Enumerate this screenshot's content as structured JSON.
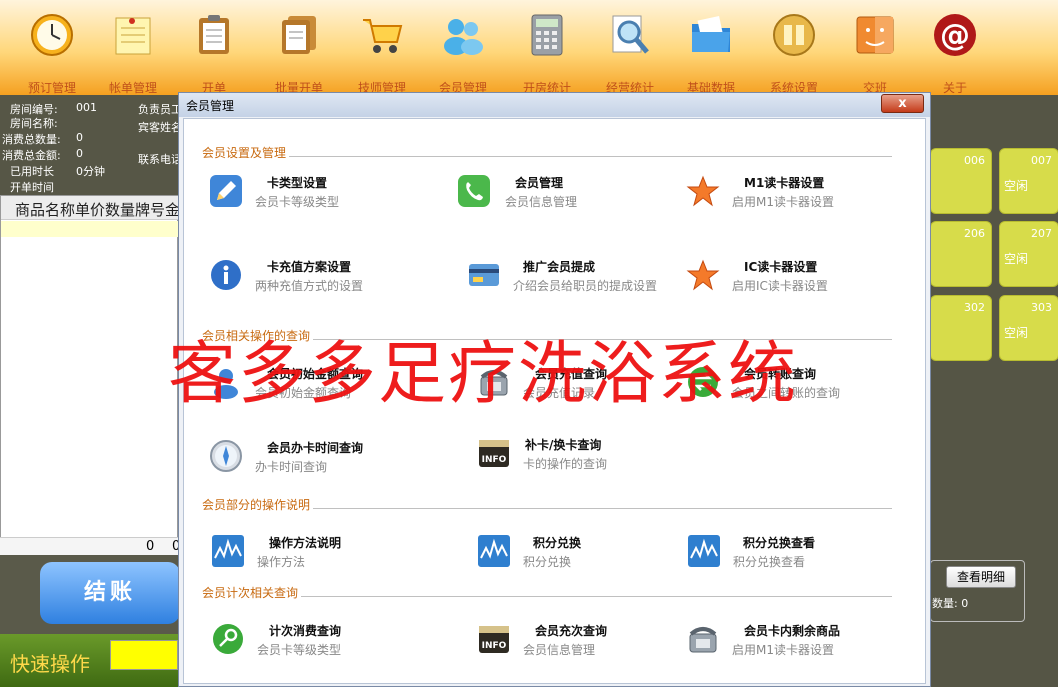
{
  "toolbar": {
    "items": [
      {
        "label": "预订管理",
        "icon": "clock-icon"
      },
      {
        "label": "帐单管理",
        "icon": "notepad-icon"
      },
      {
        "label": "开单",
        "icon": "clipboard-icon"
      },
      {
        "label": "批量开单",
        "icon": "clipboard-batch-icon"
      },
      {
        "label": "技师管理",
        "icon": "cart-icon"
      },
      {
        "label": "会员管理",
        "icon": "members-icon"
      },
      {
        "label": "开房统计",
        "icon": "calculator-icon"
      },
      {
        "label": "经营统计",
        "icon": "magnifier-icon"
      },
      {
        "label": "基础数据",
        "icon": "folder-icon"
      },
      {
        "label": "系统设置",
        "icon": "books-icon"
      },
      {
        "label": "交班",
        "icon": "handover-icon"
      },
      {
        "label": "关于",
        "icon": "at-icon"
      }
    ]
  },
  "left_info": {
    "room_no_label": "房间编号:",
    "room_no_value": "001",
    "room_name_label": "房间名称:",
    "consume_count_label": "消费总数量:",
    "consume_count_value": "0",
    "consume_amount_label": "消费总金额:",
    "consume_amount_value": "0",
    "used_time_label": "已用时长",
    "used_time_value": "0分钟",
    "open_time_label": "开单时间",
    "responsible_label": "负责员工",
    "guest_name_label": "宾客姓名",
    "contact_label": "联系电话"
  },
  "goods_table": {
    "header": "商品名称单价数量牌号金额",
    "footer_value_1": "0",
    "footer_value_2": "0"
  },
  "checkout_label": "结账",
  "quick_label": "快速操作",
  "rooms": [
    {
      "num": "006",
      "status": ""
    },
    {
      "num": "007",
      "status": "空闲"
    },
    {
      "num": "206",
      "status": ""
    },
    {
      "num": "207",
      "status": "空闲"
    },
    {
      "num": "302",
      "status": ""
    },
    {
      "num": "303",
      "status": "空闲"
    }
  ],
  "detail": {
    "button": "查看明细",
    "count_label": "数量: 0"
  },
  "dialog": {
    "title": "会员管理",
    "close_label": "x",
    "sections": [
      {
        "title": "会员设置及管理"
      },
      {
        "title": "会员相关操作的查询"
      },
      {
        "title": "会员部分的操作说明"
      },
      {
        "title": "会员计次相关查询"
      }
    ],
    "items": [
      {
        "title": "卡类型设置",
        "desc": "会员卡等级类型",
        "icon": "pencil-icon"
      },
      {
        "title": "会员管理",
        "desc": "会员信息管理",
        "icon": "phone-icon"
      },
      {
        "title": "M1读卡器设置",
        "desc": "启用M1读卡器设置",
        "icon": "star-icon"
      },
      {
        "title": "卡充值方案设置",
        "desc": "两种充值方式的设置",
        "icon": "info-icon"
      },
      {
        "title": "推广会员提成",
        "desc": "介绍会员给职员的提成设置",
        "icon": "card-icon"
      },
      {
        "title": "IC读卡器设置",
        "desc": "启用IC读卡器设置",
        "icon": "star-icon"
      },
      {
        "title": "会员初始金额查询",
        "desc": "会员初始金额查询",
        "icon": "user-icon"
      },
      {
        "title": "会员充值查询",
        "desc": "会员充值记录",
        "icon": "telephone-icon"
      },
      {
        "title": "会员转账查询",
        "desc": "会员之间转账的查询",
        "icon": "transfer-icon"
      },
      {
        "title": "会员办卡时间查询",
        "desc": "办卡时间查询",
        "icon": "compass-icon"
      },
      {
        "title": "补卡/换卡查询",
        "desc": "卡的操作的查询",
        "icon": "info-box-icon"
      },
      {
        "title": "操作方法说明",
        "desc": "操作方法",
        "icon": "chart-icon"
      },
      {
        "title": "积分兑换",
        "desc": "积分兑换",
        "icon": "chart-icon"
      },
      {
        "title": "积分兑换查看",
        "desc": "积分兑换查看",
        "icon": "chart-icon"
      },
      {
        "title": "计次消费查询",
        "desc": "会员卡等级类型",
        "icon": "key-icon"
      },
      {
        "title": "会员充次查询",
        "desc": "会员信息管理",
        "icon": "info-box-icon"
      },
      {
        "title": "会员卡内剩余商品",
        "desc": "启用M1读卡器设置",
        "icon": "telephone-icon"
      }
    ]
  },
  "watermark": "客多多足疗洗浴系统"
}
